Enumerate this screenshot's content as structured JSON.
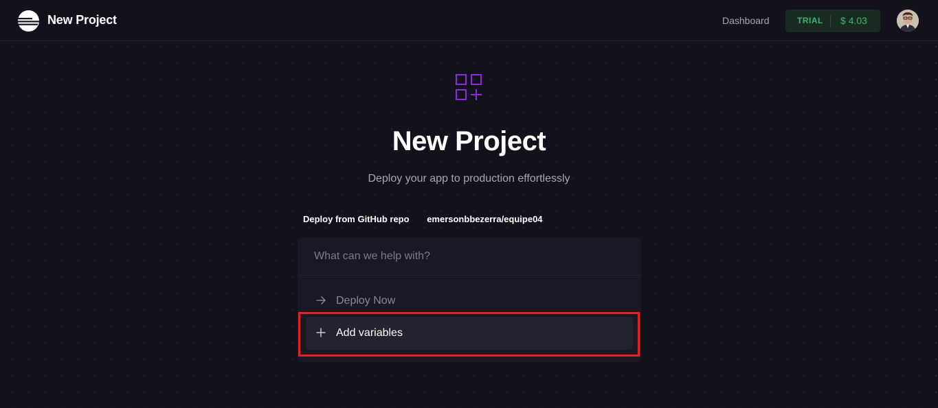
{
  "header": {
    "title": "New Project",
    "nav_dashboard": "Dashboard",
    "trial": {
      "label": "TRIAL",
      "amount": "$ 4.03"
    }
  },
  "hero": {
    "title": "New Project",
    "subtitle": "Deploy your app to production effortlessly"
  },
  "breadcrumb": {
    "source": "Deploy from GitHub repo",
    "repo": "emersonbbezerra/equipe04"
  },
  "panel": {
    "search_placeholder": "What can we help with?",
    "search_value": "",
    "options": [
      {
        "label": "Deploy Now",
        "icon": "arrow-right-icon"
      },
      {
        "label": "Add variables",
        "icon": "plus-icon"
      }
    ]
  },
  "colors": {
    "background": "#13111c",
    "accent": "#8a2be2",
    "trial_green": "#3fb56d",
    "highlight": "#e32222"
  }
}
